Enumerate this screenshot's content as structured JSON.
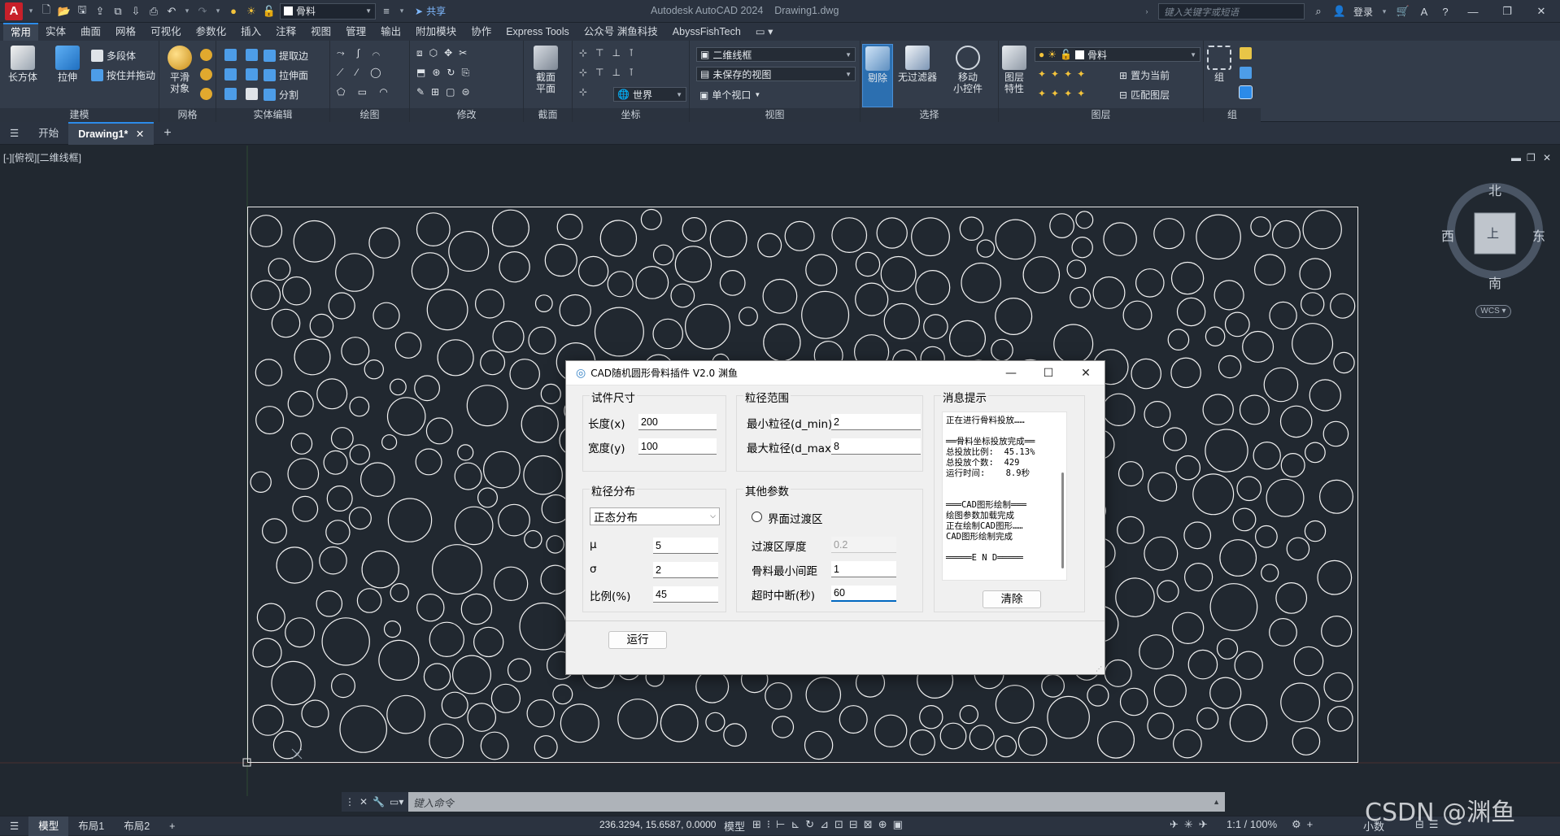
{
  "app": {
    "title": "Autodesk AutoCAD 2024",
    "drawing": "Drawing1.dwg",
    "search_placeholder": "键入关键字或短语",
    "signin": "登录",
    "share": "共享",
    "layer_combo": "骨料"
  },
  "menu_tabs": [
    "常用",
    "实体",
    "曲面",
    "网格",
    "可视化",
    "参数化",
    "插入",
    "注释",
    "视图",
    "管理",
    "输出",
    "附加模块",
    "协作",
    "Express Tools",
    "公众号 渊鱼科技",
    "AbyssFishTech"
  ],
  "ribbon": {
    "box": "长方体",
    "extrude": "拉伸",
    "polysolid": "多段体",
    "presspull": "按住并拖动",
    "smooth": "平滑\n对象",
    "extract_edges": "提取边",
    "extrude_face": "拉伸面",
    "separate": "分割",
    "section_plane": "截面\n平面",
    "visual_style": "二维线框",
    "view_saved": "未保存的视图",
    "ucs_world": "世界",
    "single_viewport": "单个视口",
    "cull": "剔除",
    "no_filter": "无过滤器",
    "move_gizmo": "移动\n小控件",
    "layer_props": "图层\n特性",
    "layer_current": "骨料",
    "set_current": "置为当前",
    "match_layer": "匹配图层",
    "group": "组",
    "panels": [
      "建模",
      "网格",
      "实体编辑",
      "绘图",
      "修改",
      "截面",
      "坐标",
      "视图",
      "选择",
      "图层",
      "组"
    ]
  },
  "doc_tabs": {
    "start": "开始",
    "drawing": "Drawing1*"
  },
  "viewport": {
    "label": "[-][俯视][二维线框]",
    "compass": {
      "north": "北",
      "south": "南",
      "east": "东",
      "west": "西",
      "top": "上"
    },
    "wcs": "WCS"
  },
  "command": {
    "placeholder": "键入命令"
  },
  "status": {
    "tabs": [
      "模型",
      "布局1",
      "布局2"
    ],
    "coords": "236.3294, 15.6587, 0.0000",
    "model": "模型",
    "scale": "1:1 / 100%",
    "units": "小数"
  },
  "watermark": "CSDN @渊鱼",
  "dialog": {
    "title": "CAD随机圆形骨料插件 V2.0 渊鱼",
    "size": {
      "label": "试件尺寸",
      "length_lbl": "长度(x)",
      "length": "200",
      "width_lbl": "宽度(y)",
      "width": "100"
    },
    "range": {
      "label": "粒径范围",
      "dmin_lbl": "最小粒径(d_min)",
      "dmin": "2",
      "dmax_lbl": "最大粒径(d_max)",
      "dmax": "8"
    },
    "dist": {
      "label": "粒径分布",
      "type": "正态分布",
      "mu_lbl": "μ",
      "mu": "5",
      "sigma_lbl": "σ",
      "sigma": "2",
      "ratio_lbl": "比例(%)",
      "ratio": "45"
    },
    "other": {
      "label": "其他参数",
      "itz_lbl": "界面过渡区",
      "itz_checked": false,
      "itz_thick_lbl": "过渡区厚度",
      "itz_thick": "0.2",
      "min_gap_lbl": "骨料最小间距",
      "min_gap": "1",
      "timeout_lbl": "超时中断(秒)",
      "timeout": "60"
    },
    "messages": {
      "label": "消息提示",
      "lines": [
        "正在进行骨料投放……",
        "",
        "══骨料坐标投放完成══",
        "总投放比例:  45.13%",
        "总投放个数:  429",
        "运行时间:    8.9秒",
        "",
        "",
        "═══CAD图形绘制═══",
        "绘图参数加载完成",
        "正在绘制CAD图形……",
        "CAD图形绘制完成",
        "",
        "═════E N D═════"
      ],
      "clear": "清除"
    },
    "run": "运行"
  }
}
